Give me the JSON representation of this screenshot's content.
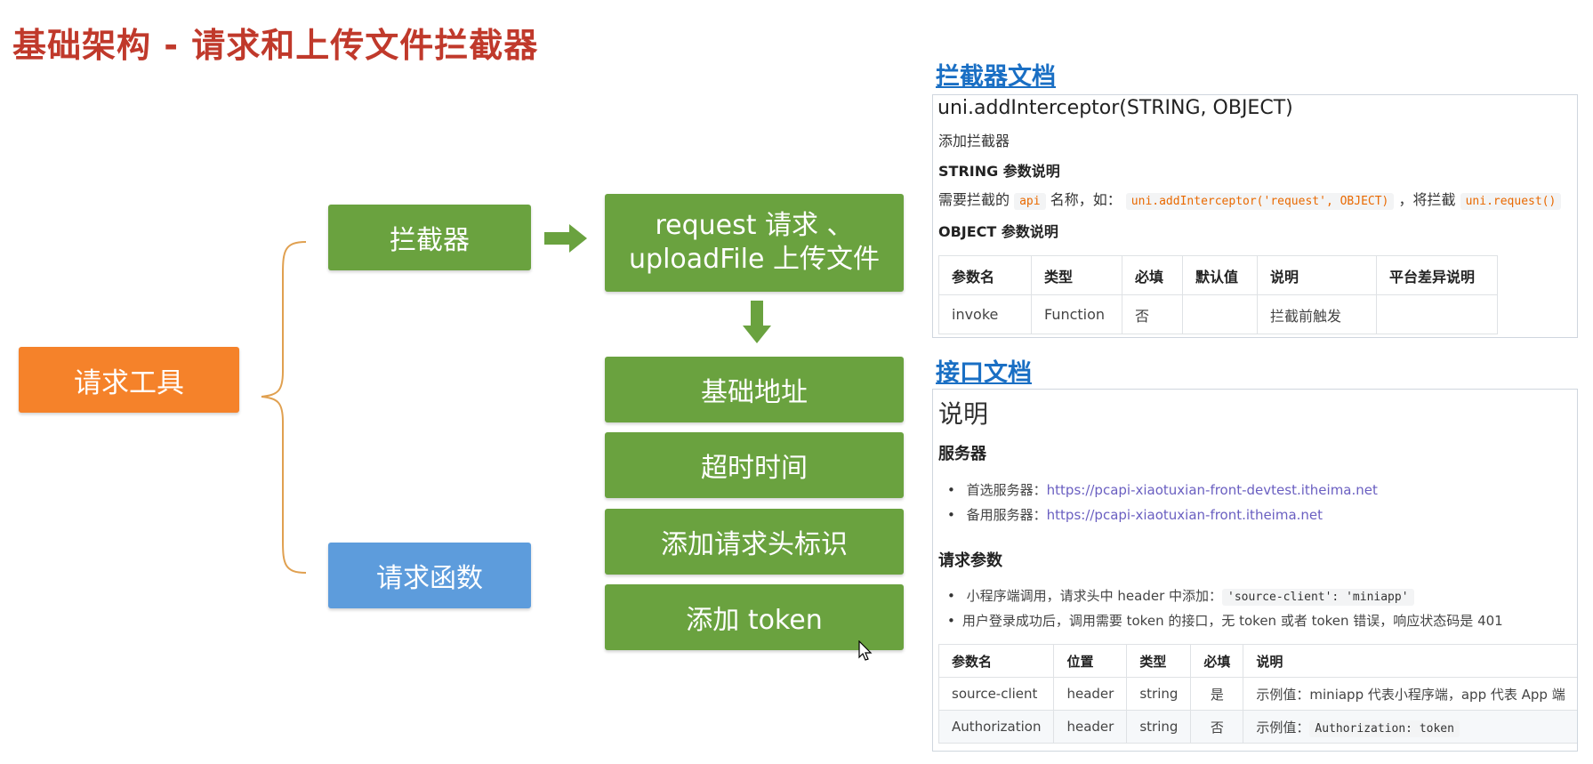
{
  "title": "基础架构 - 请求和上传文件拦截器",
  "diagram": {
    "tool": "请求工具",
    "interceptor": "拦截器",
    "func": "请求函数",
    "req_line1": "request 请求 、",
    "req_line2": "uploadFile 上传文件",
    "base": "基础地址",
    "timeout": "超时时间",
    "header": "添加请求头标识",
    "token": "添加 token"
  },
  "colors": {
    "title": "#c0392b",
    "green": "#6aa23f",
    "orange": "#f5822a",
    "blue": "#5d9cdc",
    "link": "#1a6fc4"
  },
  "interceptor_doc": {
    "link": "拦截器文档",
    "api_title": "uni.addInterceptor(STRING, OBJECT)",
    "desc": "添加拦截器",
    "string_head": "STRING 参数说明",
    "need_pre": "需要拦截的",
    "code_api": "api",
    "need_mid": "名称，如：",
    "code_example": "uni.addInterceptor('request', OBJECT)",
    "need_mid2": "，将拦截",
    "code_request": "uni.request()",
    "object_head": "OBJECT 参数说明",
    "table": {
      "headers": [
        "参数名",
        "类型",
        "必填",
        "默认值",
        "说明",
        "平台差异说明"
      ],
      "rows": [
        [
          "invoke",
          "Function",
          "否",
          "",
          "拦截前触发",
          ""
        ]
      ]
    }
  },
  "api_doc": {
    "link": "接口文档",
    "heading": "说明",
    "server_head": "服务器",
    "primary_label": "首选服务器：",
    "primary_url": "https://pcapi-xiaotuxian-front-devtest.itheima.net",
    "backup_label": "备用服务器：",
    "backup_url": "https://pcapi-xiaotuxian-front.itheima.net",
    "params_head": "请求参数",
    "note1_pre": "小程序端调用，请求头中 header 中添加：",
    "note1_code": "'source-client': 'miniapp'",
    "note2": "用户登录成功后，调用需要 token 的接口，无 token 或者 token 错误，响应状态码是 401",
    "table": {
      "headers": [
        "参数名",
        "位置",
        "类型",
        "必填",
        "说明"
      ],
      "rows": [
        [
          "source-client",
          "header",
          "string",
          "是",
          "示例值：miniapp 代表小程序端，app 代表 App 端"
        ],
        [
          "Authorization",
          "header",
          "string",
          "否",
          "示例值："
        ]
      ],
      "auth_code": "Authorization: token"
    }
  }
}
